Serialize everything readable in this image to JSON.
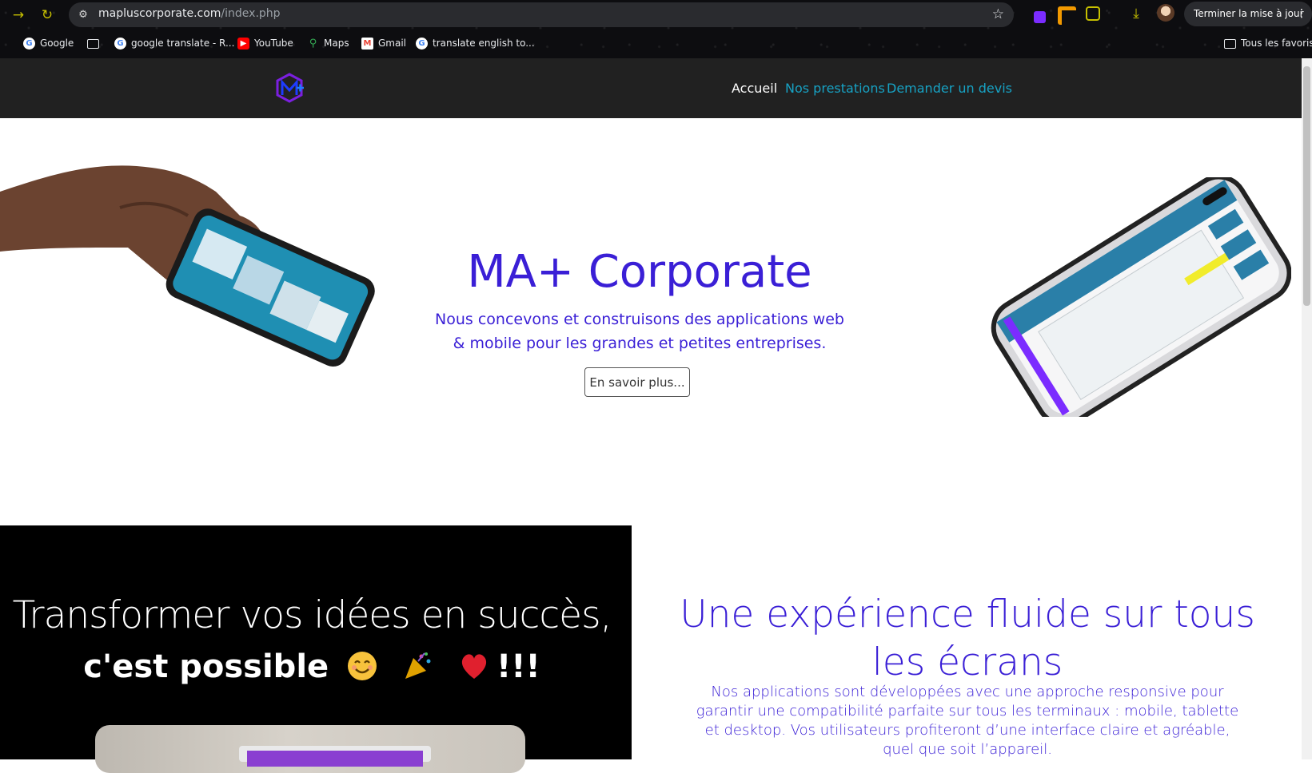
{
  "browser": {
    "url_host": "mapluscorporate.com",
    "url_path": "/index.php",
    "update_button": "Terminer la mise à jour",
    "bookmarks": [
      {
        "label": "Google",
        "icon": "google-icon"
      },
      {
        "label": "",
        "icon": "folder-icon"
      },
      {
        "label": "google translate - R...",
        "icon": "google-icon"
      },
      {
        "label": "YouTube",
        "icon": "youtube-icon"
      },
      {
        "label": "Maps",
        "icon": "maps-icon"
      },
      {
        "label": "Gmail",
        "icon": "gmail-icon"
      },
      {
        "label": "translate english to...",
        "icon": "google-icon"
      }
    ],
    "all_bookmarks": "Tous les favoris"
  },
  "nav": {
    "items": [
      {
        "label": "Accueil",
        "active": true
      },
      {
        "label": "Nos prestations",
        "active": false
      },
      {
        "label": "Demander un devis",
        "active": false
      }
    ]
  },
  "hero": {
    "title": "MA+ Corporate",
    "subtitle": "Nous concevons et construisons des applications web & mobile pour les grandes et petites entreprises.",
    "button": "En savoir plus..."
  },
  "section_left": {
    "line1": "Transformer vos idées en succès,",
    "line2_text": "c'est possible",
    "line2_suffix": "!!!",
    "emojis": [
      "smiling-face-emoji",
      "party-popper-emoji",
      "red-heart-emoji"
    ]
  },
  "section_right": {
    "title": "Une expérience fluide sur tous les écrans",
    "text": "Nos applications sont développées avec une approche responsive pour garantir une compatibilité parfaite sur tous les terminaux : mobile, tablette et desktop. Vos utilisateurs profiteront d’une interface claire et agréable, quel que soit l’appareil."
  },
  "colors": {
    "brand": "#3a1fd6",
    "nav_bg": "#212121",
    "nav_link": "#17a2c4"
  }
}
